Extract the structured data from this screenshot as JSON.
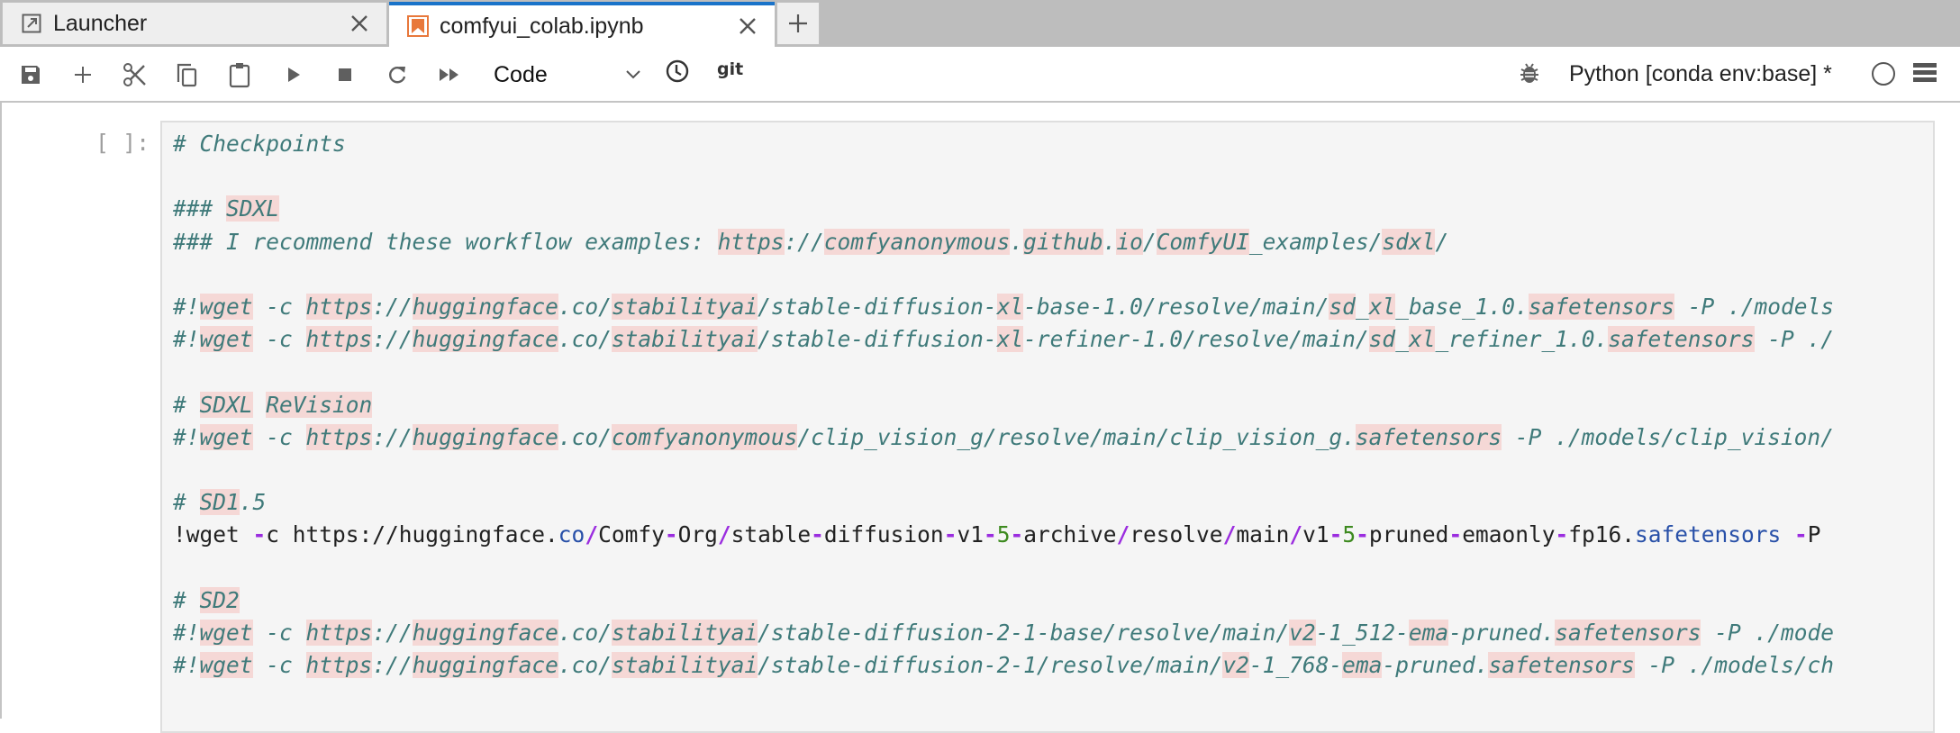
{
  "tabs": [
    {
      "label": "Launcher",
      "icon": "external-link-icon",
      "active": false
    },
    {
      "label": "comfyui_colab.ipynb",
      "icon": "notebook-icon",
      "active": true
    }
  ],
  "toolbar": {
    "buttons": [
      "save",
      "insert-cell",
      "cut",
      "copy",
      "paste",
      "run",
      "interrupt",
      "restart",
      "restart-run-all"
    ],
    "cell_type": "Code",
    "git_label": "git",
    "kernel_name": "Python [conda env:base] *"
  },
  "cell": {
    "prompt": "[ ]:",
    "lines": [
      "# Checkpoints",
      "",
      "### SDXL",
      "### I recommend these workflow examples: https://comfyanonymous.github.io/ComfyUI_examples/sdxl/",
      "",
      "#!wget -c https://huggingface.co/stabilityai/stable-diffusion-xl-base-1.0/resolve/main/sd_xl_base_1.0.safetensors -P ./models",
      "#!wget -c https://huggingface.co/stabilityai/stable-diffusion-xl-refiner-1.0/resolve/main/sd_xl_refiner_1.0.safetensors -P ./",
      "",
      "# SDXL ReVision",
      "#!wget -c https://huggingface.co/comfyanonymous/clip_vision_g/resolve/main/clip_vision_g.safetensors -P ./models/clip_vision/",
      "",
      "# SD1.5",
      "!wget -c https://huggingface.co/Comfy-Org/stable-diffusion-v1-5-archive/resolve/main/v1-5-pruned-emaonly-fp16.safetensors -P",
      "",
      "# SD2",
      "#!wget -c https://huggingface.co/stabilityai/stable-diffusion-2-1-base/resolve/main/v2-1_512-ema-pruned.safetensors -P ./mode",
      "#!wget -c https://huggingface.co/stabilityai/stable-diffusion-2-1/resolve/main/v2-1_768-ema-pruned.safetensors -P ./models/ch"
    ]
  },
  "colors": {
    "active_tab_accent": "#1a73c9",
    "comment": "#3f7a7a",
    "spellcheck_highlight": "#f5d8d6",
    "operator": "#9b2ddf",
    "number": "#3d8a1f",
    "property": "#2850a8"
  }
}
